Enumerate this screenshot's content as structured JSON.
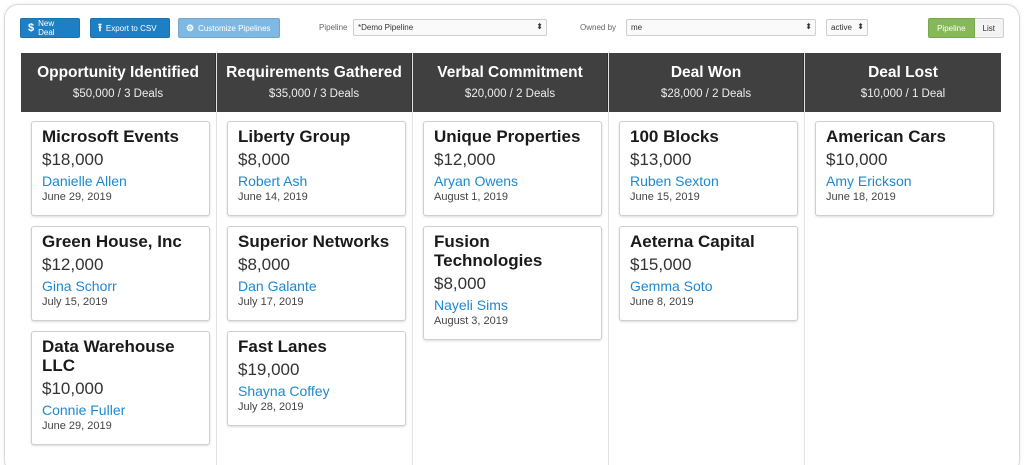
{
  "toolbar": {
    "new_deal": "New Deal",
    "new_deal_icon": "dollar-icon",
    "export_csv": "Export to CSV",
    "export_icon": "upload-icon",
    "customize": "Customize Pipelines",
    "customize_icon": "gear-icon",
    "pipeline_label": "Pipeline",
    "pipeline_value": "*Demo Pipeline",
    "owned_by_label": "Owned by",
    "owned_by_value": "me",
    "status_value": "active",
    "view_pipeline": "Pipeline",
    "view_list": "List"
  },
  "colors": {
    "accent_blue": "#1e7fc4",
    "header_dark": "#404040",
    "owner_link": "#1e88d0",
    "toggle_active": "#86b85a"
  },
  "columns": [
    {
      "title": "Opportunity Identified",
      "summary": "$50,000 / 3 Deals",
      "deals": [
        {
          "name": "Microsoft Events",
          "amount": "$18,000",
          "owner": "Danielle Allen",
          "date": "June 29, 2019"
        },
        {
          "name": "Green House, Inc",
          "amount": "$12,000",
          "owner": "Gina Schorr",
          "date": "July 15, 2019"
        },
        {
          "name": "Data Warehouse LLC",
          "amount": "$10,000",
          "owner": "Connie Fuller",
          "date": "June 29, 2019"
        }
      ]
    },
    {
      "title": "Requirements Gathered",
      "summary": "$35,000 / 3 Deals",
      "deals": [
        {
          "name": "Liberty Group",
          "amount": "$8,000",
          "owner": "Robert Ash",
          "date": "June 14, 2019"
        },
        {
          "name": "Superior Networks",
          "amount": "$8,000",
          "owner": "Dan Galante",
          "date": "July 17, 2019"
        },
        {
          "name": "Fast Lanes",
          "amount": "$19,000",
          "owner": "Shayna Coffey",
          "date": "July 28, 2019"
        }
      ]
    },
    {
      "title": "Verbal Commitment",
      "summary": "$20,000 / 2 Deals",
      "deals": [
        {
          "name": "Unique Properties",
          "amount": "$12,000",
          "owner": "Aryan Owens",
          "date": "August 1, 2019"
        },
        {
          "name": "Fusion Technologies",
          "amount": "$8,000",
          "owner": "Nayeli Sims",
          "date": "August 3, 2019"
        }
      ]
    },
    {
      "title": "Deal Won",
      "summary": "$28,000 / 2 Deals",
      "deals": [
        {
          "name": "100 Blocks",
          "amount": "$13,000",
          "owner": "Ruben Sexton",
          "date": "June 15, 2019"
        },
        {
          "name": "Aeterna Capital",
          "amount": "$15,000",
          "owner": "Gemma Soto",
          "date": "June 8, 2019"
        }
      ]
    },
    {
      "title": "Deal Lost",
      "summary": "$10,000 / 1 Deal",
      "deals": [
        {
          "name": "American Cars",
          "amount": "$10,000",
          "owner": "Amy Erickson",
          "date": "June 18, 2019"
        }
      ]
    }
  ]
}
